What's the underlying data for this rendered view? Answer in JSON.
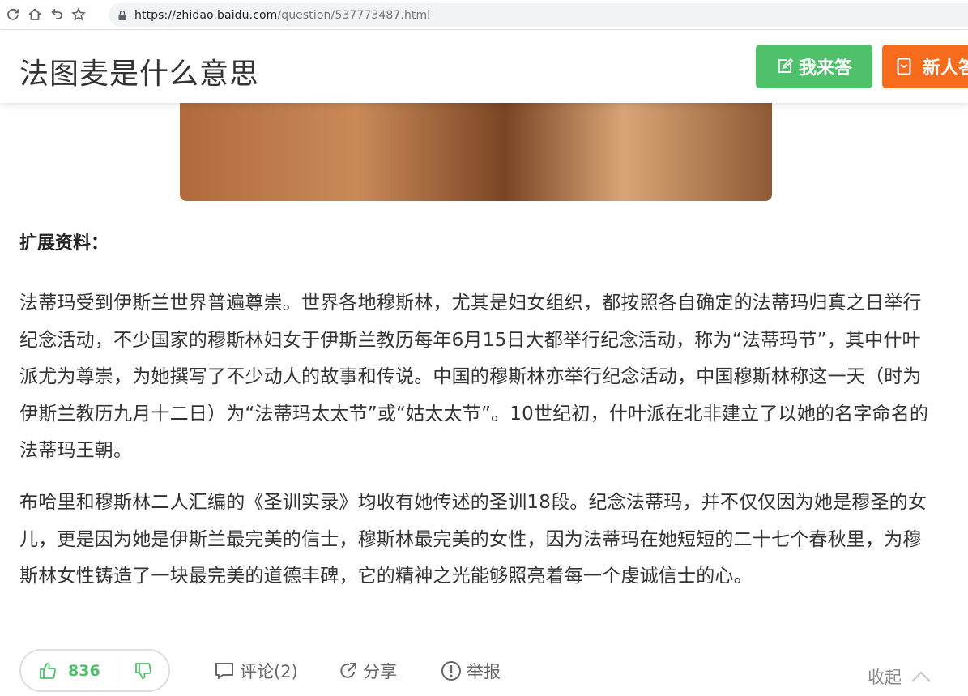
{
  "browser": {
    "url_host": "https://zhidao.baidu.com",
    "url_path": "/question/537773487.html"
  },
  "header": {
    "title": "法图麦是什么意思",
    "answer_button": "我来答",
    "newbie_button": "新人答"
  },
  "content": {
    "heading": "扩展资料：",
    "paragraph1": "法蒂玛受到伊斯兰世界普遍尊崇。世界各地穆斯林，尤其是妇女组织，都按照各自确定的法蒂玛归真之日举行纪念活动，不少国家的穆斯林妇女于伊斯兰教历每年6月15日大都举行纪念活动，称为“法蒂玛节”，其中什叶派尤为尊崇，为她撰写了不少动人的故事和传说。中国的穆斯林亦举行纪念活动，中国穆斯林称这一天（时为伊斯兰教历九月十二日）为“法蒂玛太太节”或“姑太太节”。10世纪初，什叶派在北非建立了以她的名字命名的法蒂玛王朝。",
    "paragraph2": "布哈里和穆斯林二人汇编的《圣训实录》均收有她传述的圣训18段。纪念法蒂玛，并不仅仅因为她是穆圣的女儿，更是因为她是伊斯兰最完美的信士，穆斯林最完美的女性，因为法蒂玛在她短短的二十七个春秋里，为穆斯林女性铸造了一块最完美的道德丰碑，它的精神之光能够照亮着每一个虔诚信士的心。"
  },
  "actions": {
    "like_count": "836",
    "comment": "评论(2)",
    "share": "分享",
    "report": "举报",
    "collapse": "收起"
  },
  "colors": {
    "answer_green": "#4fc16b",
    "newbie_orange": "#f76b1c"
  }
}
